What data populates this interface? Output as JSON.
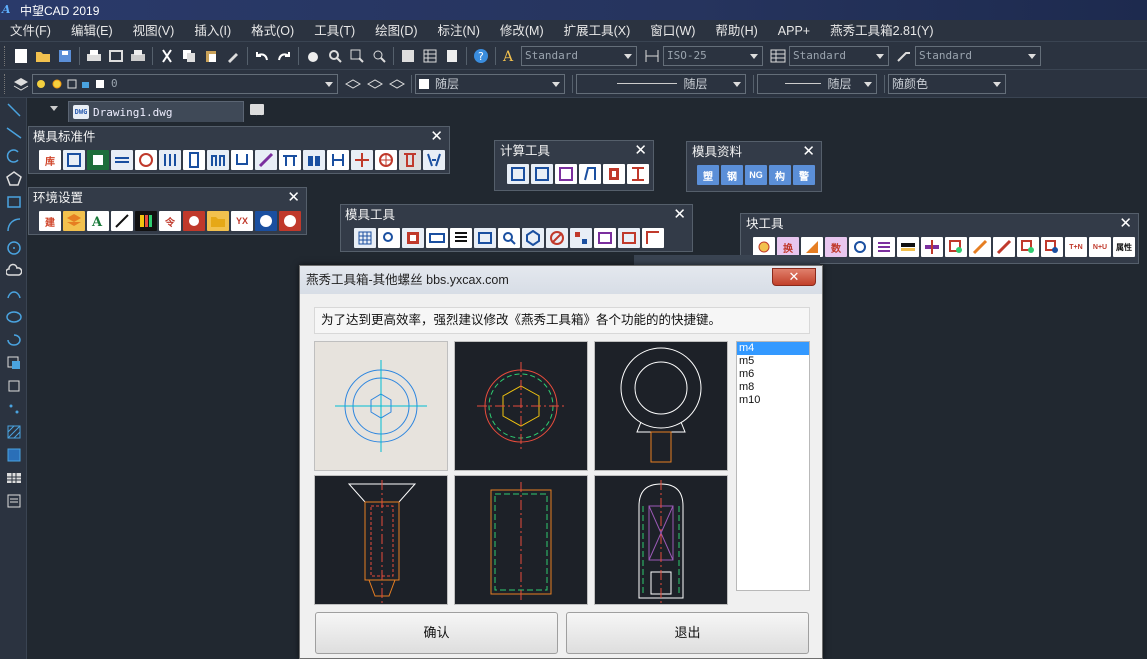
{
  "titlebar": {
    "title": "中望CAD 2019"
  },
  "menu": [
    "文件(F)",
    "编辑(E)",
    "视图(V)",
    "插入(I)",
    "格式(O)",
    "工具(T)",
    "绘图(D)",
    "标注(N)",
    "修改(M)",
    "扩展工具(X)",
    "窗口(W)",
    "帮助(H)",
    "APP+",
    "燕秀工具箱2.81(Y)"
  ],
  "toolbar": {
    "text_style": "Standard",
    "dim_style": "ISO-25",
    "table_style": "Standard",
    "multileader_style": "Standard",
    "layer": "0",
    "color": "随层",
    "linetype": "随层",
    "lineweight": "随层",
    "plot_style": "随颜色"
  },
  "tabs": {
    "drawing": "Drawing1.dwg",
    "dwg_badge": "DWG"
  },
  "palettes": {
    "mold_standard": "模具标准件",
    "environment": "环境设置",
    "mold_tools": "模具工具",
    "calc_tools": "计算工具",
    "mold_data": "模具资料",
    "block_tools": "块工具"
  },
  "palette_icon_labels": {
    "standard_lib": "库",
    "env_build": "建",
    "env_yx": "YX",
    "data_1": "塑",
    "data_2": "钢",
    "data_3": "NG",
    "data_4": "构",
    "data_5": "警",
    "block_swap": "换",
    "block_num": "数",
    "block_tn": "T+N",
    "block_nu": "N+U",
    "block_attr": "属性"
  },
  "dialog": {
    "title": "燕秀工具箱-其他螺丝  bbs.yxcax.com",
    "hint": "为了达到更高效率，强烈建议修改《燕秀工具箱》各个功能的的快捷键。",
    "sizes": [
      "m4",
      "m5",
      "m6",
      "m8",
      "m10"
    ],
    "selected_size": "m4",
    "ok": "确认",
    "exit": "退出"
  },
  "colors": {
    "accent": "#3399ff",
    "canvas": "#212830",
    "toolbar": "#2b3340"
  }
}
